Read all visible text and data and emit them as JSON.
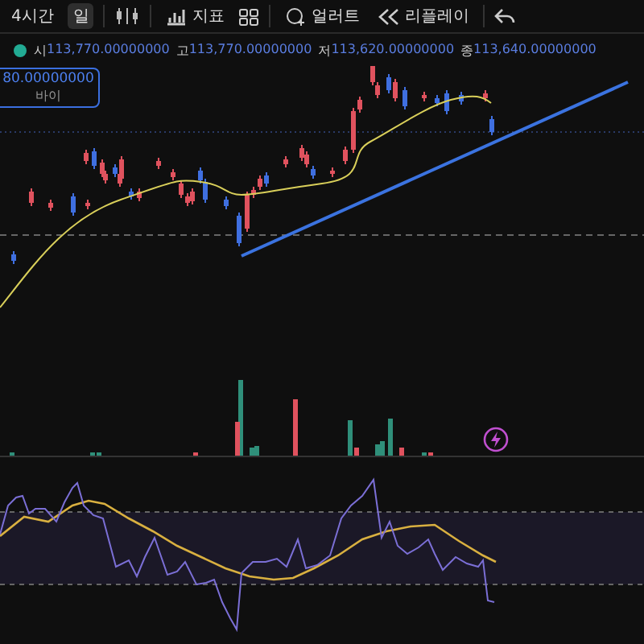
{
  "toolbar": {
    "intervals": [
      {
        "label": "4시간",
        "selected": false
      },
      {
        "label": "일",
        "selected": true
      }
    ],
    "buttons": [
      {
        "kind": "indicators",
        "label": "지표"
      },
      {
        "kind": "layout"
      },
      {
        "kind": "alert",
        "label": "얼러트"
      },
      {
        "kind": "replay",
        "label": "리플레이"
      },
      {
        "kind": "undo"
      }
    ]
  },
  "legend": [
    {
      "label": "시",
      "value": "113,770.00000000"
    },
    {
      "label": "고",
      "value": "113,770.00000000"
    },
    {
      "label": "저",
      "value": "113,620.00000000"
    },
    {
      "label": "종",
      "value": "113,640.00000000"
    }
  ],
  "price_tag": {
    "value": "80.00000000",
    "label": "바이"
  }
}
